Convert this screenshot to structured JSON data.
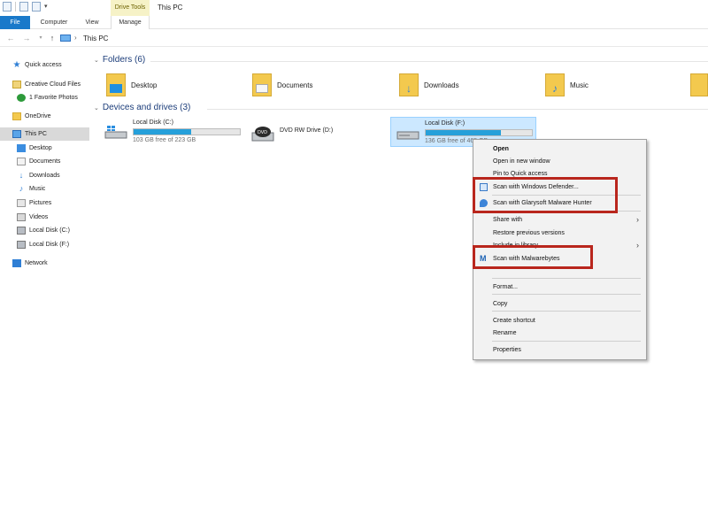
{
  "titlebar": {
    "context_tab": "Drive Tools",
    "window_title": "This PC"
  },
  "ribbon": {
    "tabs": [
      "File",
      "Computer",
      "View",
      "Manage"
    ]
  },
  "address": {
    "path": "This PC"
  },
  "nav": {
    "items": [
      {
        "label": "Quick access",
        "icon": "star-icon"
      },
      {
        "label": "Creative Cloud Files",
        "icon": "creative-cloud-icon"
      },
      {
        "label": "1 Favorite Photos",
        "icon": "favorite-photos-icon"
      },
      {
        "label": "OneDrive",
        "icon": "folder-icon"
      },
      {
        "label": "This PC",
        "icon": "computer-icon"
      },
      {
        "label": "Desktop",
        "icon": "desktop-icon"
      },
      {
        "label": "Documents",
        "icon": "documents-icon"
      },
      {
        "label": "Downloads",
        "icon": "download-icon"
      },
      {
        "label": "Music",
        "icon": "music-icon"
      },
      {
        "label": "Pictures",
        "icon": "pictures-icon"
      },
      {
        "label": "Videos",
        "icon": "videos-icon"
      },
      {
        "label": "Local Disk (C:)",
        "icon": "disk-icon"
      },
      {
        "label": "Local Disk (F:)",
        "icon": "disk-icon"
      },
      {
        "label": "Network",
        "icon": "network-icon"
      }
    ]
  },
  "folders": {
    "header": "Folders (6)",
    "items": [
      {
        "label": "Desktop",
        "icon": "desktop-folder-icon"
      },
      {
        "label": "Documents",
        "icon": "documents-folder-icon"
      },
      {
        "label": "Downloads",
        "icon": "downloads-folder-icon"
      },
      {
        "label": "Music",
        "icon": "music-folder-icon"
      }
    ]
  },
  "drives": {
    "header": "Devices and drives (3)",
    "items": [
      {
        "name": "Local Disk (C:)",
        "free": "103 GB free of 223 GB",
        "used_fraction": 0.54
      },
      {
        "name": "DVD RW Drive (D:)"
      },
      {
        "name": "Local Disk (F:)",
        "free": "136 GB free of 465 GB",
        "used_fraction": 0.71
      }
    ]
  },
  "context_menu": {
    "items": [
      "Open",
      "Open in new window",
      "Pin to Quick access",
      "Scan with Windows Defender...",
      "Scan with Glarysoft Malware Hunter",
      "Share with",
      "Restore previous versions",
      "Include in library",
      "Scan with Malwarebytes",
      "Format...",
      "Copy",
      "Create shortcut",
      "Rename",
      "Properties"
    ]
  },
  "colors": {
    "accent": "#1979ca",
    "highlight_box": "#b9261d",
    "drive_bar": "#26a0da",
    "selection": "#cce8ff"
  }
}
